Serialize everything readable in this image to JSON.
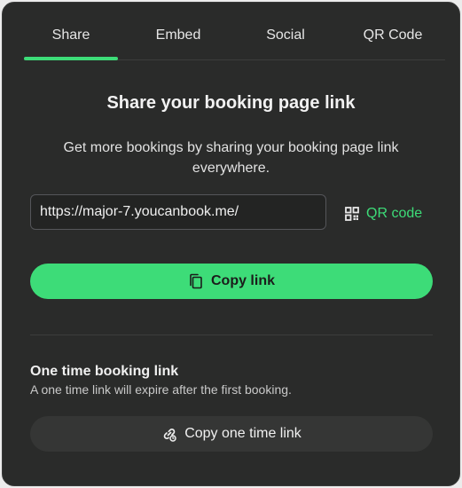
{
  "tabs": [
    {
      "label": "Share",
      "active": true
    },
    {
      "label": "Embed",
      "active": false
    },
    {
      "label": "Social",
      "active": false
    },
    {
      "label": "QR Code",
      "active": false
    }
  ],
  "share": {
    "heading": "Share your booking page link",
    "description": "Get more bookings by sharing your booking page link everywhere.",
    "link_value": "https://major-7.youcanbook.me/",
    "qr_label": "QR code",
    "qr_icon": "qr-code-icon",
    "copy_label": "Copy link",
    "copy_icon": "copy-icon"
  },
  "one_time": {
    "title": "One time booking link",
    "description": "A one time link will expire after the first booking.",
    "button_label": "Copy one time link",
    "button_icon": "one-time-link-icon"
  },
  "colors": {
    "accent": "#3ddc78",
    "panel_background": "#2a2b2a"
  }
}
